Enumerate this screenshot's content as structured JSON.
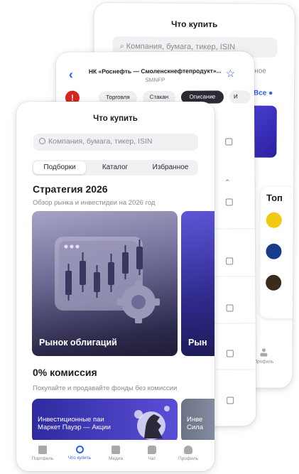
{
  "back_screen": {
    "title": "Что купить",
    "search_placeholder": "Компания, бумага, тикер, ISIN",
    "partial_field": "ное",
    "all_link": "Все",
    "top_label": "Топ",
    "profile_tab": "Профиль"
  },
  "middle_screen": {
    "title": "НК «Роснефть — Смоленскнефтепродукт»...",
    "ticker": "SMNFP",
    "tabs": [
      {
        "label": "Торговля"
      },
      {
        "label": "Стакан"
      },
      {
        "label": "Описание"
      },
      {
        "label": "И"
      }
    ]
  },
  "front_screen": {
    "title": "Что купить",
    "search_placeholder": "Компания, бумага, тикер, ISIN",
    "segments": [
      {
        "label": "Подборки"
      },
      {
        "label": "Каталог"
      },
      {
        "label": "Избранное"
      }
    ],
    "section1": {
      "heading": "Стратегия 2026",
      "subtitle": "Обзор рынка и инвестидеи на 2026 год",
      "card_main": "Рынок облигаций",
      "card_next": "Рын"
    },
    "section2": {
      "heading": "0% комиссия",
      "subtitle": "Покупайте и продавайте фонды без комиссии",
      "card_main_line1": "Инвестиционные паи",
      "card_main_line2": "Маркет Пауэр — Акции",
      "card_next_line1": "Инве",
      "card_next_line2": "Сила"
    },
    "tabbar": [
      {
        "label": "Портфель"
      },
      {
        "label": "Что купить"
      },
      {
        "label": "Медиа"
      },
      {
        "label": "Чат"
      },
      {
        "label": "Профиль"
      }
    ]
  },
  "colors": {
    "accent": "#2c5cf0",
    "rosneft_red": "#d7261e",
    "bond_card": "#2d2b4d",
    "fund_card": "#2f2a9e"
  }
}
